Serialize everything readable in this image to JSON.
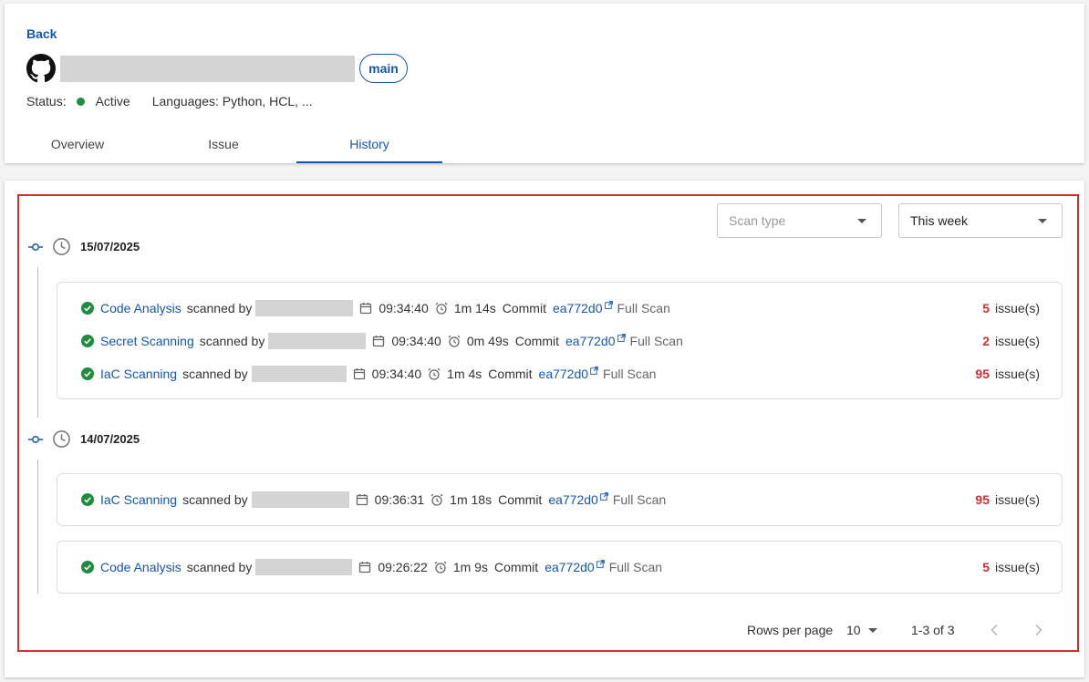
{
  "header": {
    "back_label": "Back",
    "branch": "main",
    "status_label": "Status:",
    "status_value": "Active",
    "status_color": "#1e8e3e",
    "languages": "Languages: Python, HCL, ..."
  },
  "tabs": [
    {
      "label": "Overview",
      "active": false
    },
    {
      "label": "Issue",
      "active": false
    },
    {
      "label": "History",
      "active": true
    }
  ],
  "filters": {
    "scan_type_placeholder": "Scan type",
    "period": "This week"
  },
  "history": [
    {
      "date": "15/07/2025",
      "groups": [
        [
          {
            "name": "Code Analysis",
            "by": "scanned by",
            "time": "09:34:40",
            "duration": "1m 14s",
            "commit_label": "Commit",
            "commit": "ea772d0",
            "kind": "Full Scan",
            "issues": "5",
            "issues_label": "issue(s)"
          },
          {
            "name": "Secret Scanning",
            "by": "scanned by",
            "time": "09:34:40",
            "duration": "0m 49s",
            "commit_label": "Commit",
            "commit": "ea772d0",
            "kind": "Full Scan",
            "issues": "2",
            "issues_label": "issue(s)"
          },
          {
            "name": "IaC Scanning",
            "by": "scanned by",
            "time": "09:34:40",
            "duration": "1m 4s",
            "commit_label": "Commit",
            "commit": "ea772d0",
            "kind": "Full Scan",
            "issues": "95",
            "issues_label": "issue(s)"
          }
        ]
      ]
    },
    {
      "date": "14/07/2025",
      "groups": [
        [
          {
            "name": "IaC Scanning",
            "by": "scanned by",
            "time": "09:36:31",
            "duration": "1m 18s",
            "commit_label": "Commit",
            "commit": "ea772d0",
            "kind": "Full Scan",
            "issues": "95",
            "issues_label": "issue(s)"
          }
        ],
        [
          {
            "name": "Code Analysis",
            "by": "scanned by",
            "time": "09:26:22",
            "duration": "1m 9s",
            "commit_label": "Commit",
            "commit": "ea772d0",
            "kind": "Full Scan",
            "issues": "5",
            "issues_label": "issue(s)"
          }
        ]
      ]
    }
  ],
  "pagination": {
    "rows_per_page_label": "Rows per page",
    "rows_per_page": "10",
    "range": "1-3 of 3"
  },
  "colors": {
    "accent": "#1557b0",
    "issue_count": "#d32f2f",
    "success": "#1e8e3e",
    "highlight_outline": "#d32f2f"
  }
}
